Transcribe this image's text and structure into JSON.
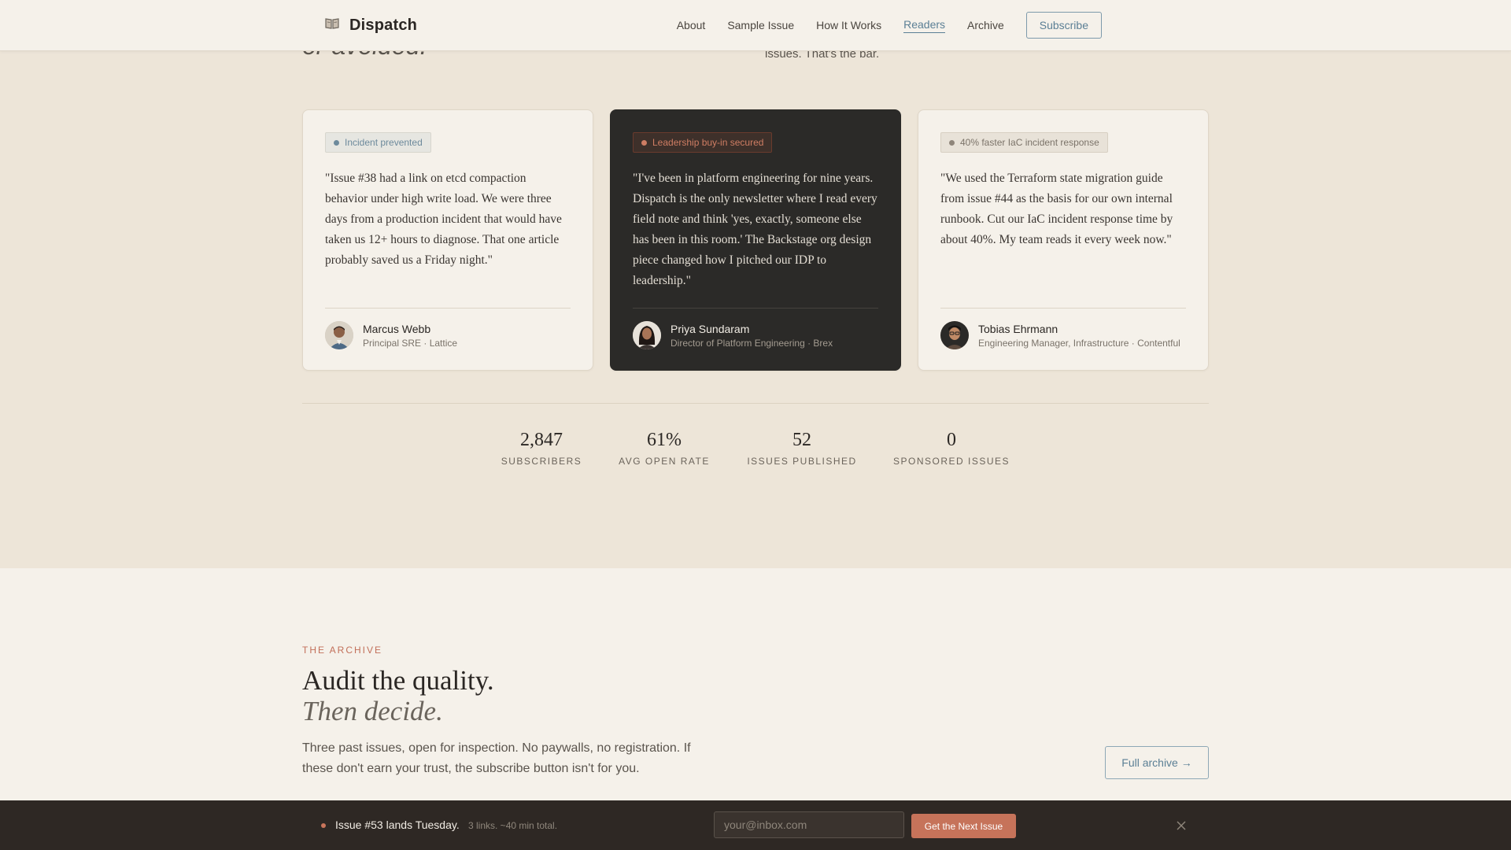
{
  "nav": {
    "brand": "Dispatch",
    "links": [
      "About",
      "Sample Issue",
      "How It Works",
      "Readers",
      "Archive"
    ],
    "active": "Readers",
    "subscribe_label": "Subscribe"
  },
  "hero_remnant": {
    "title_tail": "or avoided.",
    "note_tail": "issues. That's the bar."
  },
  "testimonials": [
    {
      "badge": "Incident prevented",
      "quote": "\"Issue #38 had a link on etcd compaction behavior under high write load. We were three days from a production incident that would have taken us 12+ hours to diagnose. That one article probably saved us a Friday night.\"",
      "name": "Marcus Webb",
      "role": "Principal SRE · Lattice"
    },
    {
      "badge": "Leadership buy-in secured",
      "quote": "\"I've been in platform engineering for nine years. Dispatch is the only newsletter where I read every field note and think 'yes, exactly, someone else has been in this room.' The Backstage org design piece changed how I pitched our IDP to leadership.\"",
      "name": "Priya Sundaram",
      "role": "Director of Platform Engineering · Brex"
    },
    {
      "badge": "40% faster IaC incident response",
      "quote": "\"We used the Terraform state migration guide from issue #44 as the basis for our own internal runbook. Cut our IaC incident response time by about 40%. My team reads it every week now.\"",
      "name": "Tobias Ehrmann",
      "role": "Engineering Manager, Infrastructure · Contentful"
    }
  ],
  "stats": [
    {
      "value": "2,847",
      "label": "SUBSCRIBERS"
    },
    {
      "value": "61%",
      "label": "AVG OPEN RATE"
    },
    {
      "value": "52",
      "label": "ISSUES PUBLISHED"
    },
    {
      "value": "0",
      "label": "SPONSORED ISSUES"
    }
  ],
  "archive": {
    "eyebrow": "THE ARCHIVE",
    "heading_line1": "Audit the quality.",
    "heading_line2": "Then decide.",
    "description": "Three past issues, open for inspection. No paywalls, no registration. If these don't earn your trust, the subscribe button isn't for you.",
    "full_archive_label": "Full archive →"
  },
  "sticky_bar": {
    "title": "Issue #53 lands Tuesday.",
    "subtitle": "3 links. ~40 min total.",
    "email_placeholder": "your@inbox.com",
    "cta_label": "Get the Next Issue"
  },
  "colors": {
    "accent_blue": "#5b7f95",
    "accent_terracotta": "#c6735a",
    "page_bg": "#ede5d8",
    "surface": "#f5f1ea",
    "dark_card": "#2b2a28",
    "bar_bg": "#2e2824"
  },
  "icons": {
    "brand": "open-book-icon",
    "close": "close-icon"
  }
}
